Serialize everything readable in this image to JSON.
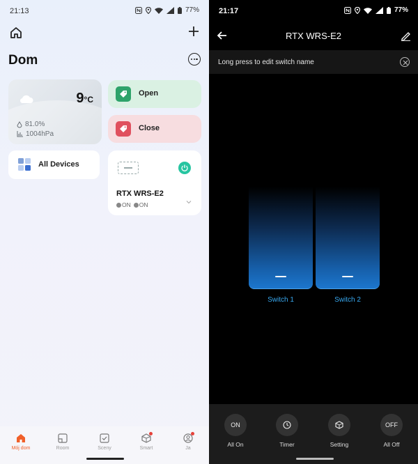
{
  "left": {
    "status_bar": {
      "time": "21:13",
      "battery": "77%",
      "network": "LTE"
    },
    "header": {
      "title": "Dom"
    },
    "weather": {
      "temperature": "9",
      "unit": "°C",
      "humidity": "81.0%",
      "pressure": "1004hPa"
    },
    "scenes": [
      {
        "label": "Open",
        "color": "#2ea36a"
      },
      {
        "label": "Close",
        "color": "#e0505e"
      }
    ],
    "all_devices": {
      "label": "All Devices"
    },
    "device": {
      "name": "RTX WRS-E2",
      "state1": "ON",
      "state2": "ON",
      "power_color": "#27c5a1"
    },
    "bottom_nav": {
      "items": [
        {
          "label": "Mój dom",
          "icon": "home-icon",
          "active": true
        },
        {
          "label": "Room",
          "icon": "room-icon"
        },
        {
          "label": "Sceny",
          "icon": "scenes-icon"
        },
        {
          "label": "Smart",
          "icon": "smart-icon"
        },
        {
          "label": "Ja",
          "icon": "profile-icon"
        }
      ],
      "accent": "#f0602a"
    }
  },
  "right": {
    "status_bar": {
      "time": "21:17",
      "battery": "77%",
      "network": "LTE"
    },
    "header": {
      "title": "RTX WRS-E2"
    },
    "hint": {
      "text": "Long press to edit switch name"
    },
    "switches": [
      {
        "label": "Switch 1"
      },
      {
        "label": "Switch 2"
      }
    ],
    "switch_color": "#1c76cd",
    "controls": [
      {
        "label": "All On",
        "glyph": "ON"
      },
      {
        "label": "Timer",
        "glyph": ""
      },
      {
        "label": "Setting",
        "glyph": ""
      },
      {
        "label": "All Off",
        "glyph": "OFF"
      }
    ]
  }
}
